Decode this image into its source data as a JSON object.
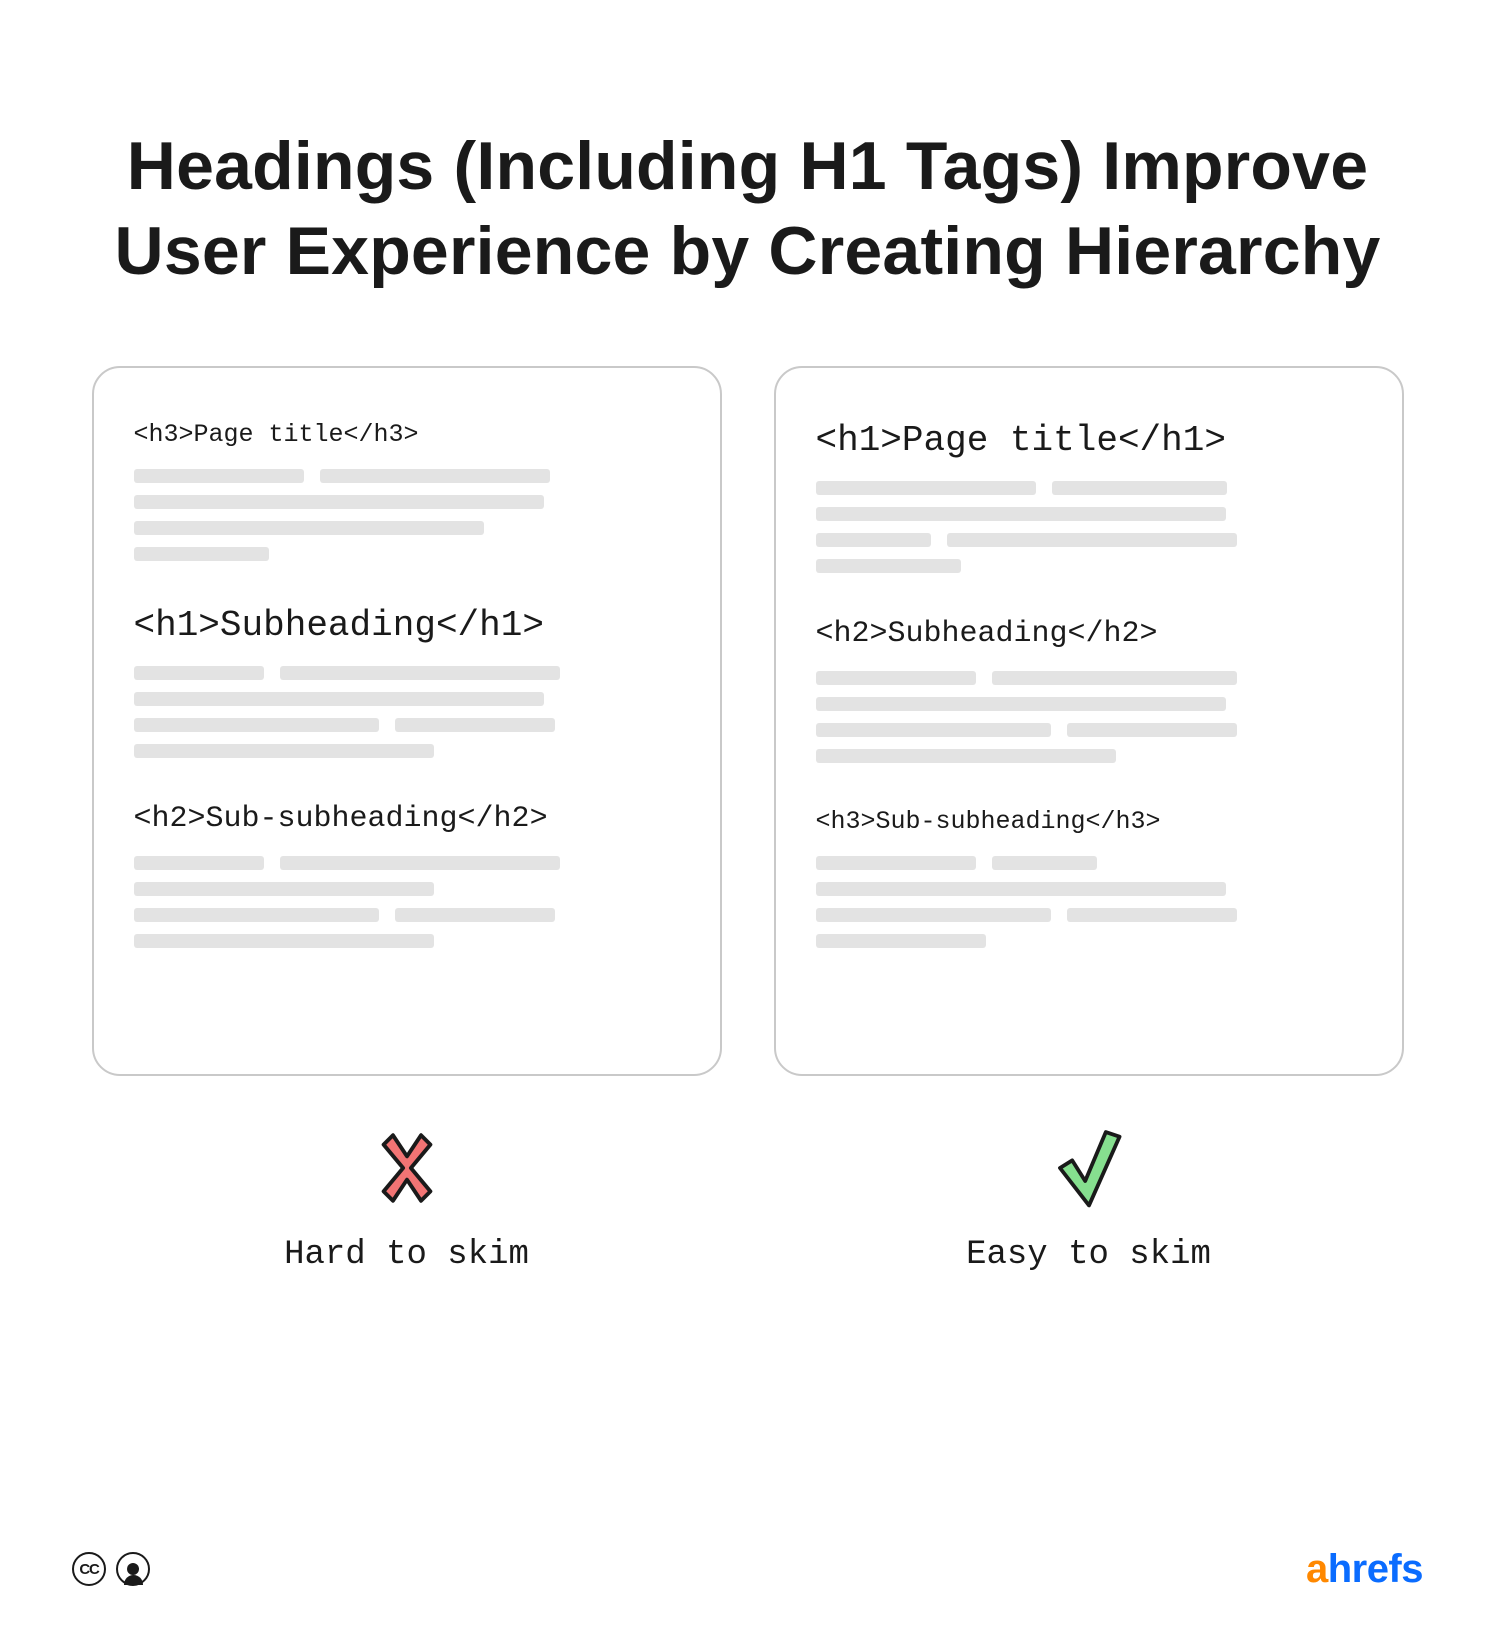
{
  "title": "Headings (Including H1 Tags) Improve User Experience by Creating Hierarchy",
  "panels": {
    "left": {
      "blocks": [
        {
          "tag": "h3",
          "text": "Page title",
          "size": "fs-small",
          "bars": [
            [
              170,
              230
            ],
            [
              410
            ],
            [
              350
            ],
            [
              135
            ]
          ]
        },
        {
          "tag": "h1",
          "text": "Subheading",
          "size": "fs-big",
          "bars": [
            [
              130,
              280
            ],
            [
              410
            ],
            [
              245,
              160
            ],
            [
              300
            ]
          ]
        },
        {
          "tag": "h2",
          "text": "Sub-subheading",
          "size": "fs-mid",
          "bars": [
            [
              130,
              280
            ],
            [
              300
            ],
            [
              245,
              160
            ],
            [
              300
            ]
          ]
        }
      ],
      "verdict": "Hard to skim",
      "verdict_icon": "cross"
    },
    "right": {
      "blocks": [
        {
          "tag": "h1",
          "text": "Page title",
          "size": "fs-big",
          "bars": [
            [
              220,
              175
            ],
            [
              410
            ],
            [
              115,
              290
            ],
            [
              145
            ]
          ]
        },
        {
          "tag": "h2",
          "text": "Subheading",
          "size": "fs-mid",
          "bars": [
            [
              160,
              245
            ],
            [
              410
            ],
            [
              235,
              170
            ],
            [
              300
            ]
          ]
        },
        {
          "tag": "h3",
          "text": "Sub-subheading",
          "size": "fs-small",
          "bars": [
            [
              160,
              105
            ],
            [
              410
            ],
            [
              235,
              170
            ],
            [
              170
            ]
          ]
        }
      ],
      "verdict": "Easy to skim",
      "verdict_icon": "check"
    }
  },
  "footer": {
    "license_icons": [
      "cc",
      "by"
    ],
    "brand": {
      "first": "a",
      "rest": "hrefs"
    }
  },
  "colors": {
    "cross_fill": "#f27474",
    "cross_stroke": "#1a1a1a",
    "check_fill": "#86df8f",
    "check_stroke": "#1a1a1a"
  }
}
